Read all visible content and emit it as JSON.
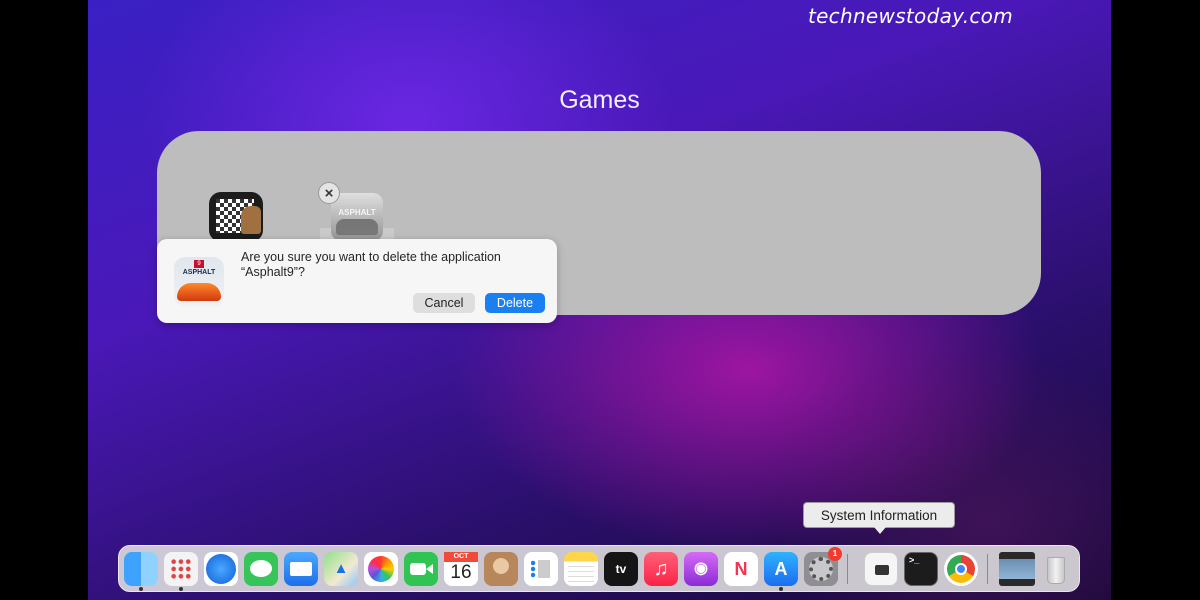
{
  "watermark": "technewstoday.com",
  "folder": {
    "title": "Games",
    "apps": [
      {
        "name": "Chess",
        "icon": "chess-icon"
      },
      {
        "name": "Asphalt9",
        "icon": "asphalt9-icon",
        "delete_badge": "×"
      }
    ]
  },
  "dialog": {
    "message": "Are you sure you want to delete the application “Asphalt9”?",
    "icon_badge": "9",
    "icon_brand": "ASPHALT",
    "cancel_label": "Cancel",
    "delete_label": "Delete",
    "accent_color": "#1a7ff0"
  },
  "ghost_icon_label": "ASPHALT",
  "tooltip": "System Information",
  "dock": {
    "items": [
      {
        "name": "finder",
        "icon": "finder-icon",
        "running": true
      },
      {
        "name": "launchpad",
        "icon": "launchpad-icon",
        "running": true
      },
      {
        "name": "safari",
        "icon": "compass-icon"
      },
      {
        "name": "messages",
        "icon": "speech-bubble-icon"
      },
      {
        "name": "mail",
        "icon": "envelope-icon"
      },
      {
        "name": "maps",
        "icon": "map-icon"
      },
      {
        "name": "photos",
        "icon": "flower-icon"
      },
      {
        "name": "facetime",
        "icon": "video-camera-icon"
      },
      {
        "name": "calendar",
        "icon": "calendar-icon",
        "month": "OCT",
        "day": "16"
      },
      {
        "name": "contacts",
        "icon": "contact-book-icon"
      },
      {
        "name": "reminders",
        "icon": "checklist-icon"
      },
      {
        "name": "notes",
        "icon": "notepad-icon"
      },
      {
        "name": "tv",
        "icon": "tv-icon",
        "label": "tv"
      },
      {
        "name": "music",
        "icon": "music-note-icon",
        "glyph": "♫"
      },
      {
        "name": "podcasts",
        "icon": "podcast-icon",
        "glyph": "◉"
      },
      {
        "name": "news",
        "icon": "news-icon",
        "glyph": "N"
      },
      {
        "name": "app-store",
        "icon": "app-store-icon",
        "glyph": "A",
        "running": true
      },
      {
        "name": "system-preferences",
        "icon": "gear-icon",
        "badge": "1"
      },
      {
        "name": "system-information",
        "icon": "chip-icon"
      },
      {
        "name": "terminal",
        "icon": "terminal-icon",
        "glyph": ">_"
      },
      {
        "name": "chrome",
        "icon": "chrome-icon"
      },
      {
        "name": "screenshot",
        "icon": "screenshot-icon"
      },
      {
        "name": "trash",
        "icon": "trash-icon"
      }
    ]
  }
}
